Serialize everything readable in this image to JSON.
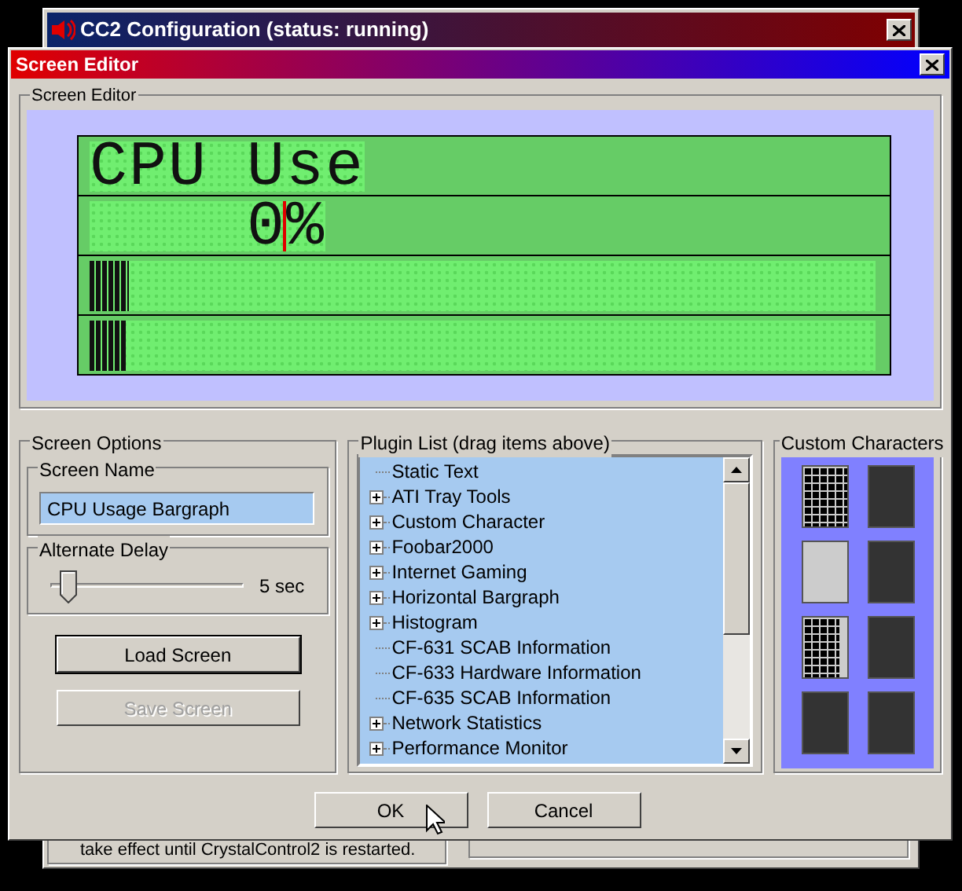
{
  "back_window": {
    "title": "CC2 Configuration (status: running)",
    "note": "take effect until CrystalControl2 is restarted."
  },
  "dialog": {
    "title": "Screen Editor",
    "screen_editor": {
      "label": "Screen Editor",
      "rows": [
        {
          "kind": "text",
          "text": "CPU Use"
        },
        {
          "kind": "text",
          "text": "    0%",
          "cursor": true
        },
        {
          "kind": "bar",
          "level": 0.05
        },
        {
          "kind": "bar",
          "level": 0.045
        }
      ]
    },
    "screen_options": {
      "label": "Screen Options",
      "screen_name": {
        "label": "Screen Name",
        "value": "CPU Usage Bargraph"
      },
      "alternate_delay": {
        "label": "Alternate Delay",
        "level": 0.08,
        "reading": "5 sec"
      },
      "buttons": [
        {
          "label": "Load Screen",
          "disabled": false,
          "default": true
        },
        {
          "label": "Save Screen",
          "disabled": true,
          "default": false
        }
      ]
    },
    "plugin_list": {
      "label": "Plugin List (drag items above)",
      "items": [
        {
          "label": "Static Text",
          "expandable": false
        },
        {
          "label": "ATI Tray Tools",
          "expandable": true
        },
        {
          "label": "Custom Character",
          "expandable": true
        },
        {
          "label": "Foobar2000",
          "expandable": true
        },
        {
          "label": "Internet Gaming",
          "expandable": true
        },
        {
          "label": "Horizontal Bargraph",
          "expandable": true
        },
        {
          "label": "Histogram",
          "expandable": true
        },
        {
          "label": "CF-631 SCAB Information",
          "expandable": false
        },
        {
          "label": "CF-633 Hardware Information",
          "expandable": false
        },
        {
          "label": "CF-635 SCAB Information",
          "expandable": false
        },
        {
          "label": "Network Statistics",
          "expandable": true
        },
        {
          "label": "Performance Monitor",
          "expandable": true
        }
      ]
    },
    "custom_characters": {
      "label": "Custom Characters",
      "chars": [
        {
          "kind": "full"
        },
        {
          "kind": "unset"
        },
        {
          "kind": "clear"
        },
        {
          "kind": "unset"
        },
        {
          "kind": "partial"
        },
        {
          "kind": "unset"
        },
        {
          "kind": "unset"
        },
        {
          "kind": "unset"
        }
      ]
    },
    "buttons": [
      {
        "label": "OK"
      },
      {
        "label": "Cancel"
      }
    ]
  }
}
